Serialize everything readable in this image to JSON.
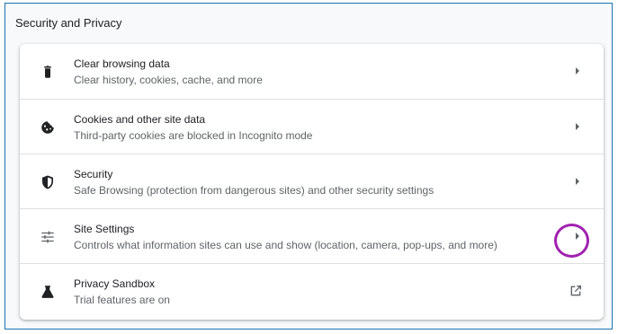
{
  "section": {
    "title": "Security and Privacy"
  },
  "rows": [
    {
      "title": "Clear browsing data",
      "desc": "Clear history, cookies, cache, and more",
      "icon": "trash-icon",
      "action": "arrow"
    },
    {
      "title": "Cookies and other site data",
      "desc": "Third-party cookies are blocked in Incognito mode",
      "icon": "cookie-icon",
      "action": "arrow"
    },
    {
      "title": "Security",
      "desc": "Safe Browsing (protection from dangerous sites) and other security settings",
      "icon": "shield-icon",
      "action": "arrow"
    },
    {
      "title": "Site Settings",
      "desc": "Controls what information sites can use and show (location, camera, pop-ups, and more)",
      "icon": "tune-icon",
      "action": "arrow"
    },
    {
      "title": "Privacy Sandbox",
      "desc": "Trial features are on",
      "icon": "flask-icon",
      "action": "external"
    }
  ],
  "colors": {
    "border": "#1a73b0",
    "highlight": "#a020b0",
    "icon": "#5f6368"
  }
}
